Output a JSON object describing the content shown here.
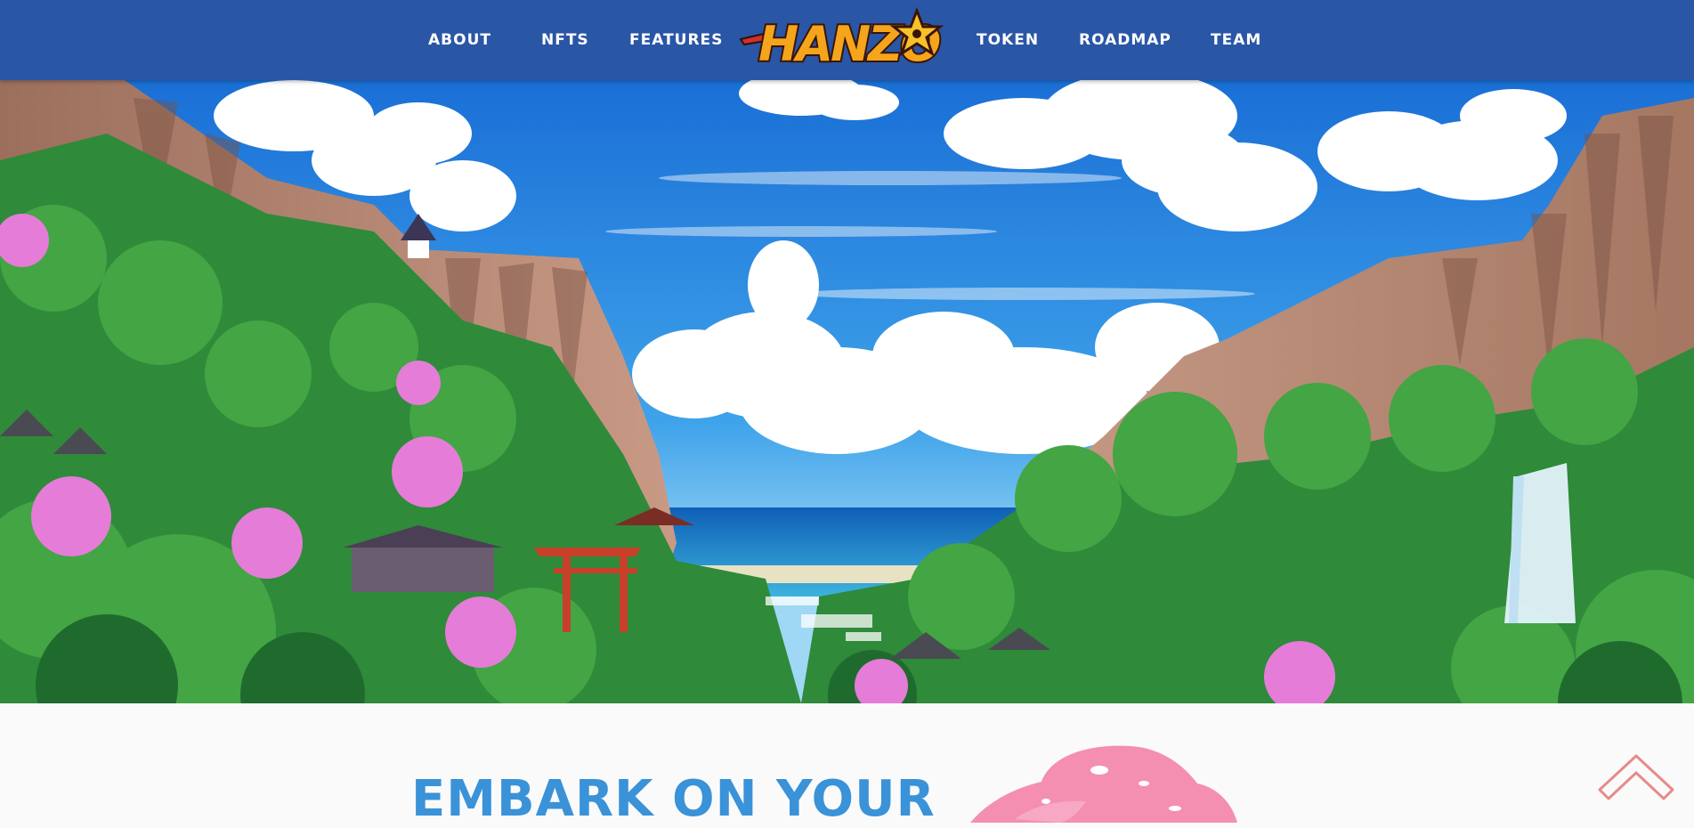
{
  "nav": {
    "items_left": [
      {
        "id": "about",
        "label": "ABOUT"
      },
      {
        "id": "nfts",
        "label": "NFTS"
      },
      {
        "id": "features",
        "label": "FEATURES"
      }
    ],
    "items_right": [
      {
        "id": "token",
        "label": "TOKEN"
      },
      {
        "id": "roadmap",
        "label": "ROADMAP"
      },
      {
        "id": "team",
        "label": "TEAM"
      }
    ],
    "logo_text": "HANZO"
  },
  "colors": {
    "nav_bg": "#2a56a6",
    "nav_text": "#ffffff",
    "headline": "#3a92d8",
    "logo_fill": "#f4a51c",
    "blossom": "#f48fb1",
    "scroll_icon": "#e88a8a"
  },
  "hero": {
    "scene": "anime-valley-landscape"
  },
  "intro": {
    "headline": "EMBARK ON YOUR"
  },
  "icons": {
    "scroll_top": "chevron-up-icon"
  }
}
